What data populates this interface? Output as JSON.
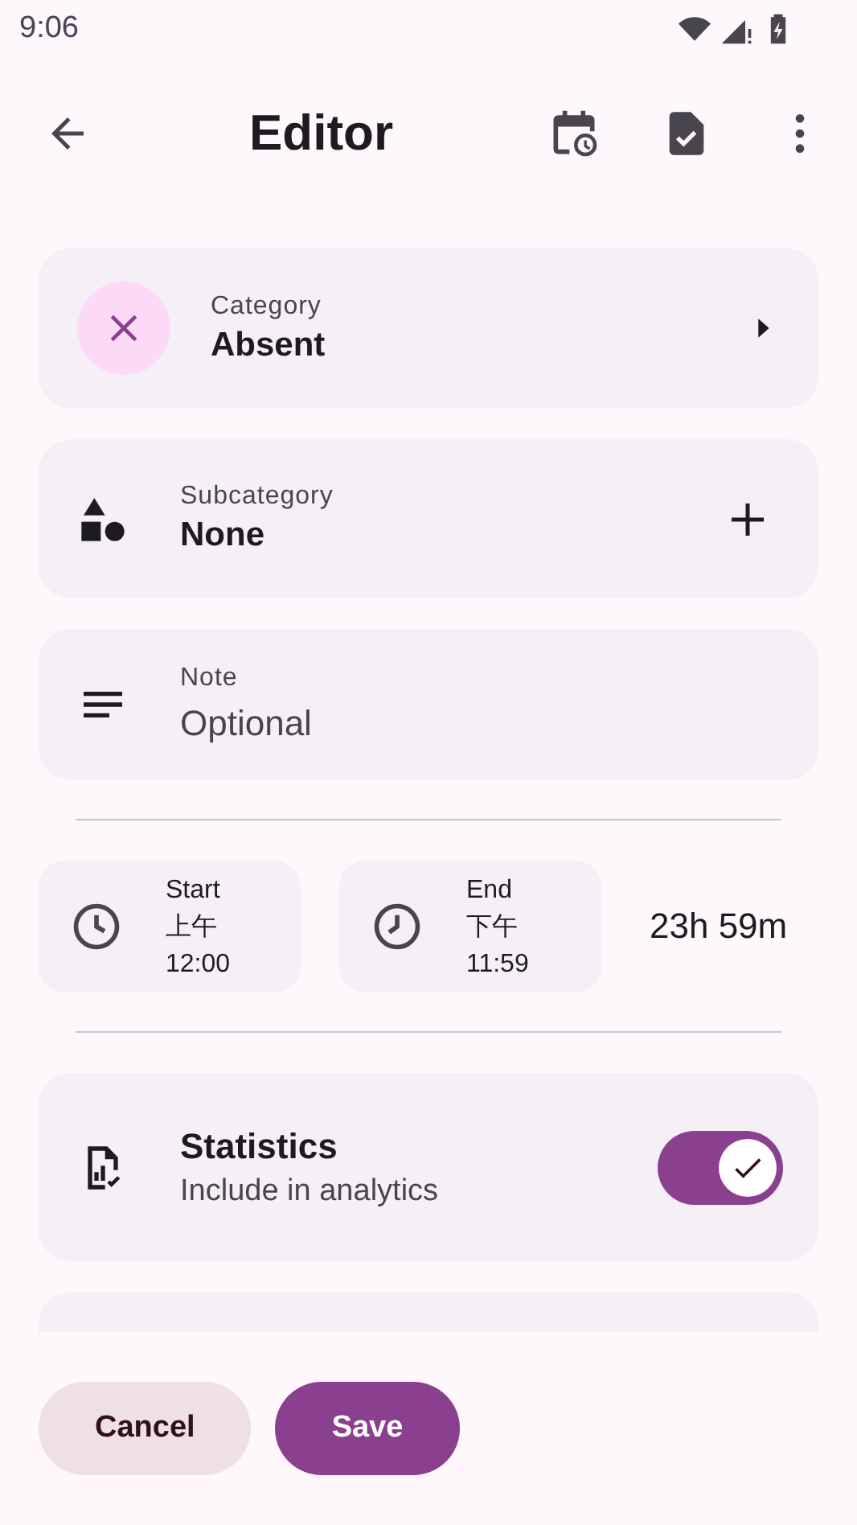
{
  "status_bar": {
    "time": "9:06"
  },
  "app_bar": {
    "title": "Editor"
  },
  "category": {
    "label": "Category",
    "value": "Absent"
  },
  "subcategory": {
    "label": "Subcategory",
    "value": "None"
  },
  "note": {
    "label": "Note",
    "value": "Optional"
  },
  "times": [
    {
      "label": "Start",
      "period": "上午",
      "time": "12:00"
    },
    {
      "label": "End",
      "period": "下午",
      "time": "11:59"
    }
  ],
  "duration": "23h 59m",
  "statistics": {
    "title": "Statistics",
    "subtitle": "Include in analytics",
    "on": true
  },
  "buttons": [
    {
      "label": "Cancel",
      "kind": "tonal"
    },
    {
      "label": "Save",
      "kind": "filled"
    }
  ]
}
